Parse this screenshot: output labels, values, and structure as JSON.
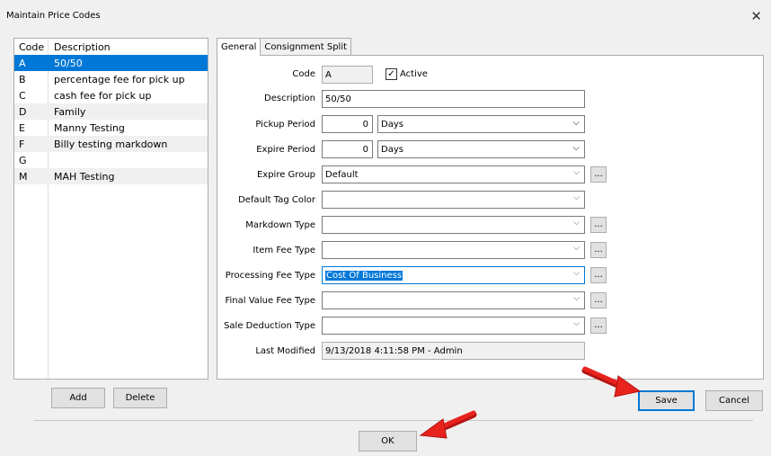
{
  "window": {
    "title": "Maintain Price Codes",
    "close_icon": "close-icon"
  },
  "list": {
    "headers": {
      "code": "Code",
      "description": "Description"
    },
    "rows": [
      {
        "code": "A",
        "description": "50/50"
      },
      {
        "code": "B",
        "description": "percentage fee for pick up"
      },
      {
        "code": "C",
        "description": "cash fee for pick up"
      },
      {
        "code": "D",
        "description": "Family"
      },
      {
        "code": "E",
        "description": "Manny Testing"
      },
      {
        "code": "F",
        "description": "Billy testing markdown"
      },
      {
        "code": "G",
        "description": ""
      },
      {
        "code": "M",
        "description": "MAH Testing"
      }
    ],
    "selected_index": 0
  },
  "buttons": {
    "add": "Add",
    "delete": "Delete",
    "save": "Save",
    "cancel": "Cancel",
    "ok": "OK"
  },
  "tabs": [
    {
      "label": "General"
    },
    {
      "label": "Consignment Split"
    }
  ],
  "form": {
    "code": {
      "label": "Code",
      "value": "A"
    },
    "active": {
      "label": "Active",
      "checked": true,
      "mark": "✓"
    },
    "description": {
      "label": "Description",
      "value": "50/50"
    },
    "pickup_period": {
      "label": "Pickup Period",
      "number": "0",
      "unit": "Days"
    },
    "expire_period": {
      "label": "Expire Period",
      "number": "0",
      "unit": "Days"
    },
    "expire_group": {
      "label": "Expire Group",
      "value": "Default"
    },
    "default_tag_color": {
      "label": "Default Tag Color",
      "value": ""
    },
    "markdown_type": {
      "label": "Markdown Type",
      "value": ""
    },
    "item_fee_type": {
      "label": "Item Fee Type",
      "value": ""
    },
    "processing_fee_type": {
      "label": "Processing Fee Type",
      "value": "Cost Of Business"
    },
    "final_value_fee_type": {
      "label": "Final Value Fee Type",
      "value": ""
    },
    "sale_deduction_type": {
      "label": "Sale Deduction Type",
      "value": ""
    },
    "last_modified": {
      "label": "Last Modified",
      "value": "9/13/2018 4:11:58 PM - Admin"
    }
  },
  "glyphs": {
    "close": "✕",
    "chevron": "⌵",
    "ellipsis": "...",
    "arrow_color": "#e8231e"
  }
}
